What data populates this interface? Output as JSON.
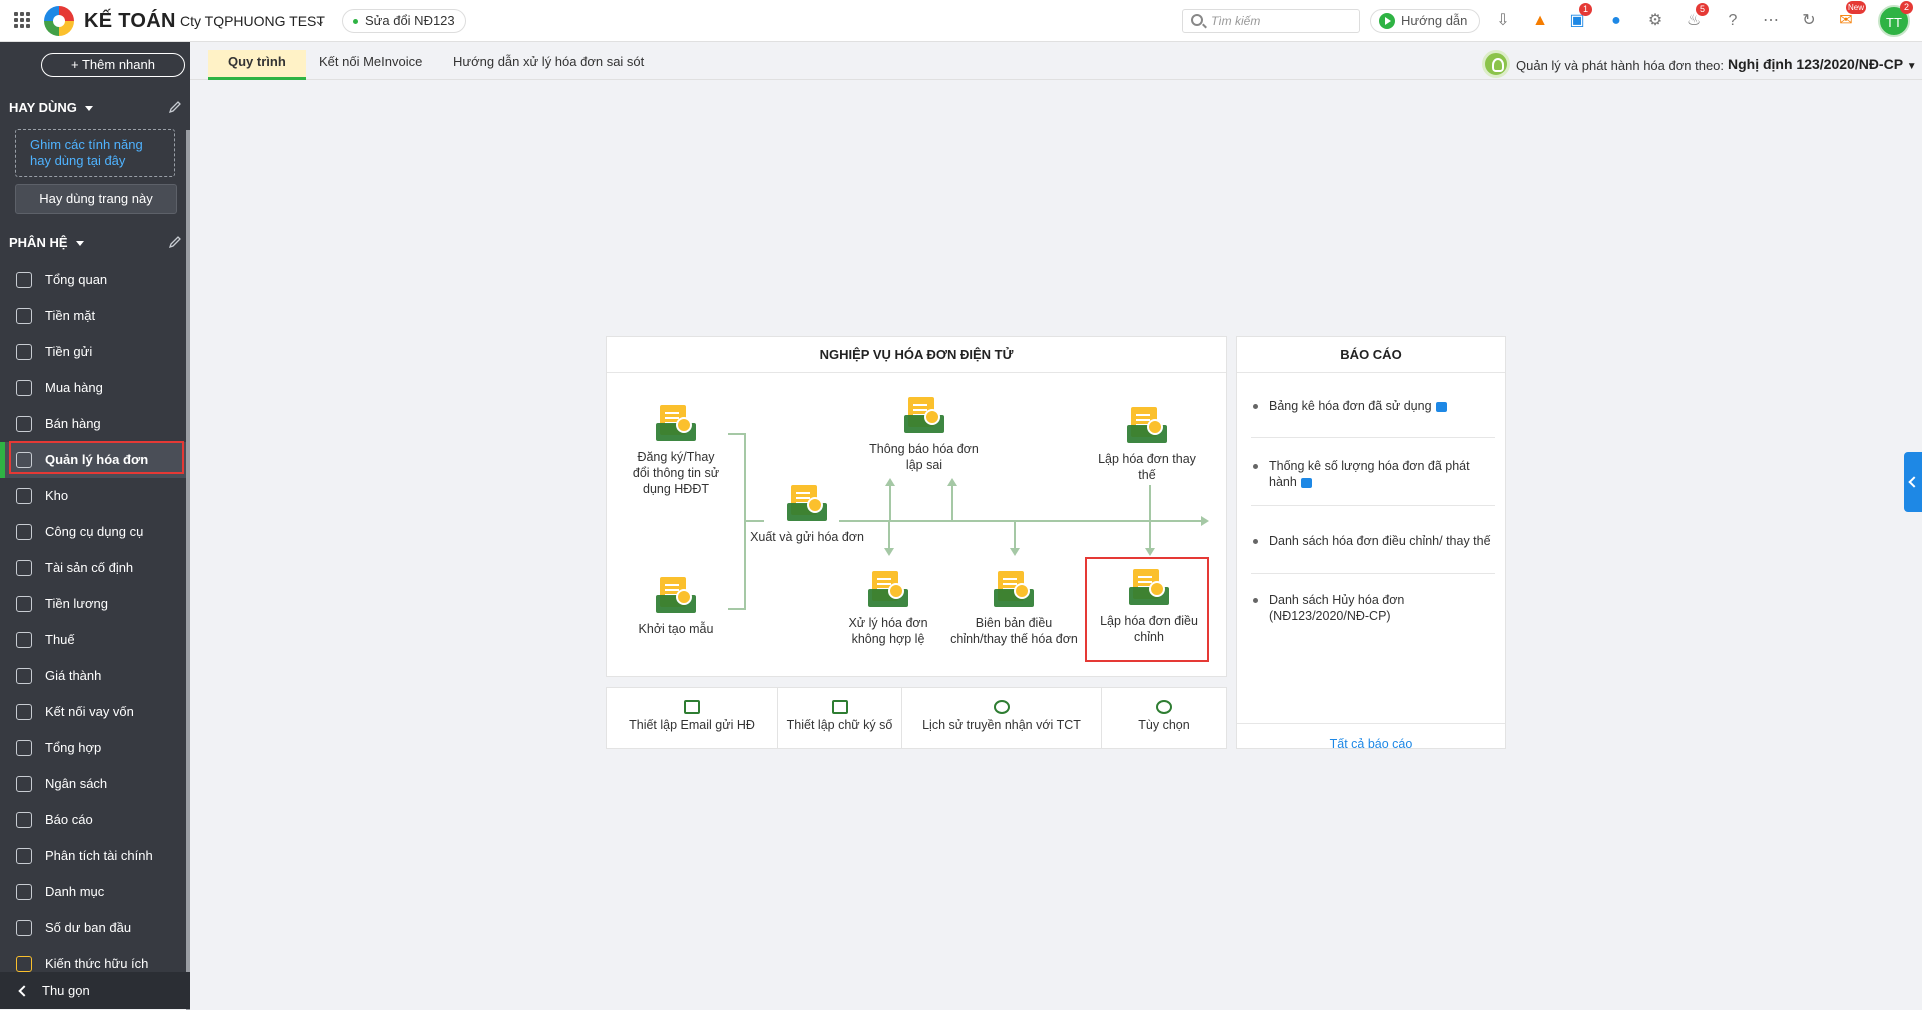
{
  "topbar": {
    "brand": "KẾ TOÁN",
    "company": "Cty TQPHUONG TEST",
    "version": "Sửa đổi NĐ123",
    "search_placeholder": "Tìm kiếm",
    "guide_label": "Hướng dẫn",
    "badges": {
      "cart": "1",
      "notifications": "5",
      "new": "New",
      "avatar": "2"
    },
    "avatar_initials": "TT"
  },
  "sidebar": {
    "quick_add": "+ Thêm nhanh",
    "favorites_title": "HAY DÙNG",
    "pin_hint": "Ghim các tính năng hay dùng tại đây",
    "use_page_button": "Hay dùng trang này",
    "modules_title": "PHÂN HỆ",
    "items": [
      {
        "label": "Tổng quan",
        "icon": "dashboard-icon"
      },
      {
        "label": "Tiền mặt",
        "icon": "cash-icon"
      },
      {
        "label": "Tiền gửi",
        "icon": "bank-icon"
      },
      {
        "label": "Mua hàng",
        "icon": "shopping-bag-icon"
      },
      {
        "label": "Bán hàng",
        "icon": "cart-icon"
      },
      {
        "label": "Quản lý hóa đơn",
        "icon": "invoice-icon"
      },
      {
        "label": "Kho",
        "icon": "warehouse-icon"
      },
      {
        "label": "Công cụ dụng cụ",
        "icon": "tools-icon"
      },
      {
        "label": "Tài sản cố định",
        "icon": "asset-icon"
      },
      {
        "label": "Tiền lương",
        "icon": "salary-icon"
      },
      {
        "label": "Thuế",
        "icon": "tax-icon"
      },
      {
        "label": "Giá thành",
        "icon": "price-tag-icon"
      },
      {
        "label": "Kết nối vay vốn",
        "icon": "loan-icon"
      },
      {
        "label": "Tổng hợp",
        "icon": "ledger-icon"
      },
      {
        "label": "Ngân sách",
        "icon": "budget-icon"
      },
      {
        "label": "Báo cáo",
        "icon": "report-icon"
      },
      {
        "label": "Phân tích tài chính",
        "icon": "analysis-icon"
      },
      {
        "label": "Danh mục",
        "icon": "list-icon"
      },
      {
        "label": "Số dư ban đầu",
        "icon": "balance-icon"
      },
      {
        "label": "Kiến thức hữu ích",
        "icon": "knowledge-icon"
      }
    ],
    "collapse_label": "Thu gọn"
  },
  "tabs": [
    "Quy trình",
    "Kết nối MeInvoice",
    "Hướng dẫn xử lý hóa đơn sai sót"
  ],
  "decree": {
    "label": "Quản lý và phát hành hóa đơn theo:",
    "value": "Nghị định 123/2020/NĐ-CP"
  },
  "workflow": {
    "title": "NGHIỆP VỤ HÓA ĐƠN ĐIỆN TỬ",
    "nodes": {
      "register": "Đăng ký/Thay đổi thông tin sử dụng HĐĐT",
      "create_template": "Khởi tạo mẫu",
      "issue_send": "Xuất và gửi hóa đơn",
      "error_notice": "Thông báo hóa đơn lập sai",
      "replace": "Lập hóa đơn thay thế",
      "invalid": "Xử lý hóa đơn không hợp lệ",
      "minutes": "Biên bản điều chỉnh/thay thế hóa đơn",
      "adjust": "Lập hóa đơn điều chỉnh"
    }
  },
  "tools": [
    {
      "label": "Thiết lập Email gửi HĐ",
      "icon": "email-icon"
    },
    {
      "label": "Thiết lập chữ ký số",
      "icon": "signature-icon"
    },
    {
      "label": "Lịch sử truyền nhận với TCT",
      "icon": "history-icon"
    },
    {
      "label": "Tùy chọn",
      "icon": "gear-icon"
    }
  ],
  "reports": {
    "title": "BÁO CÁO",
    "items": [
      "Bảng kê hóa đơn đã sử dụng",
      "Thống kê số lượng hóa đơn đã phát hành",
      "Danh sách hóa đơn điều chỉnh/ thay thế",
      "Danh sách Hủy hóa đơn (NĐ123/2020/NĐ-CP)"
    ],
    "all_link": "Tất cả báo cáo"
  },
  "colors": {
    "accent": "#2fb344",
    "sidebar": "#373a41",
    "highlight": "#e53935",
    "link": "#1e88e5"
  }
}
